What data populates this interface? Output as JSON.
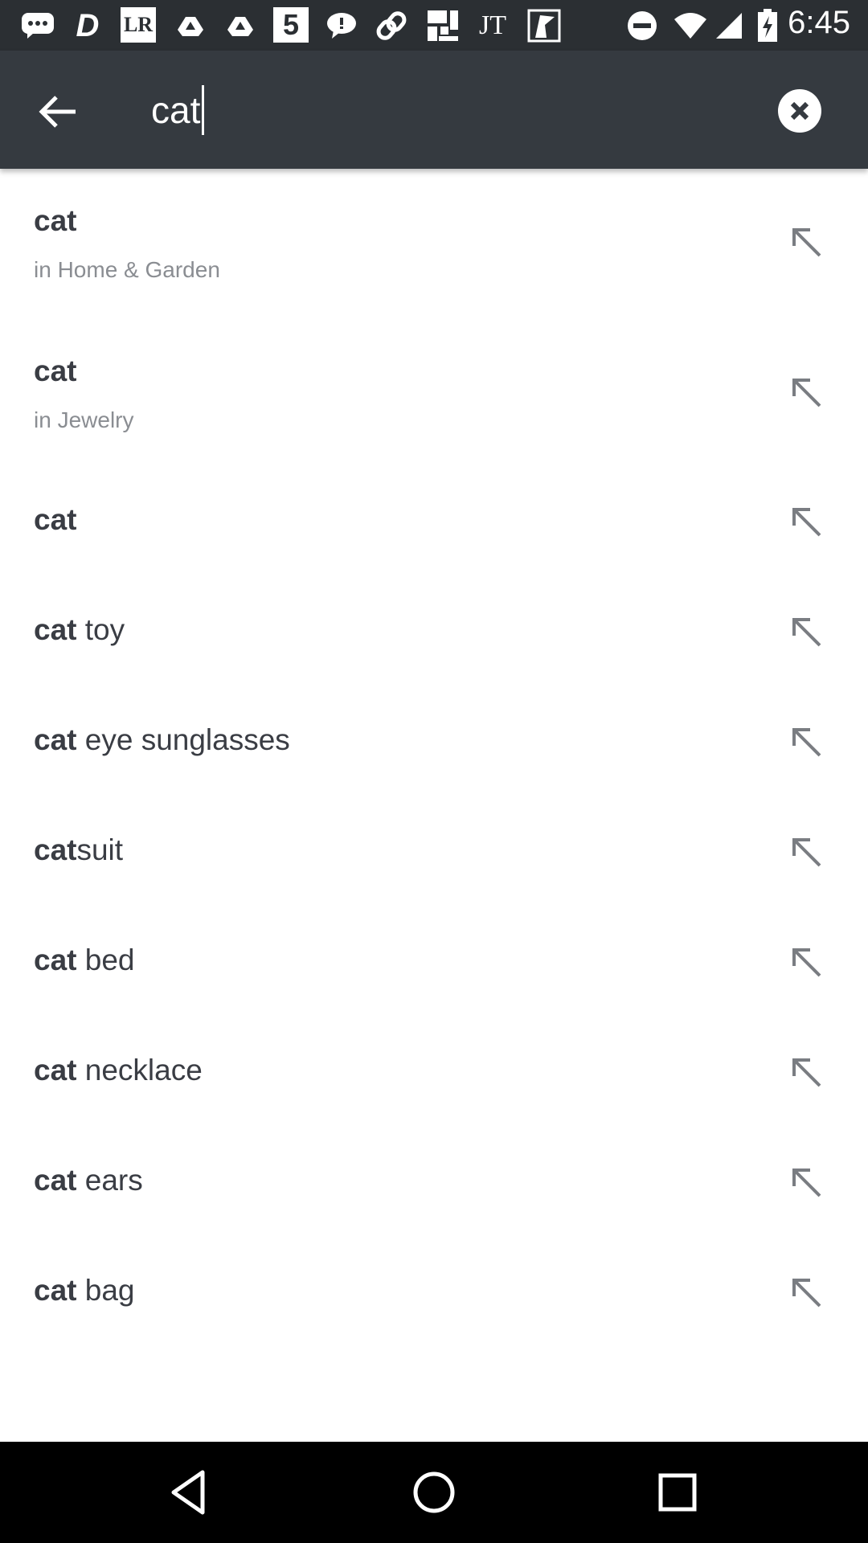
{
  "status_bar": {
    "time": "6:45",
    "notification_icons": [
      "chat-bubble-icon",
      "d-app-icon",
      "lr-app-icon",
      "cloud-drive-icon",
      "cloud-drive-icon",
      "number-5-app-icon",
      "message-icon",
      "link-app-icon",
      "grid-app-icon",
      "jt-app-icon",
      "image-app-icon"
    ],
    "notification_labels": {
      "lr": "LR",
      "jt": "JT",
      "five": "5",
      "d": "D"
    },
    "system_icons": [
      "do-not-disturb-icon",
      "wifi-icon",
      "cell-signal-icon",
      "battery-charging-icon"
    ]
  },
  "search": {
    "query": "cat"
  },
  "suggestions": [
    {
      "bold": "cat",
      "rest": "",
      "category": "in Home & Garden"
    },
    {
      "bold": "cat",
      "rest": "",
      "category": "in Jewelry"
    },
    {
      "bold": "cat",
      "rest": "",
      "category": ""
    },
    {
      "bold": "cat",
      "rest": " toy",
      "category": ""
    },
    {
      "bold": "cat",
      "rest": " eye sunglasses",
      "category": ""
    },
    {
      "bold": "cat",
      "rest": "suit",
      "category": ""
    },
    {
      "bold": "cat",
      "rest": " bed",
      "category": ""
    },
    {
      "bold": "cat",
      "rest": " necklace",
      "category": ""
    },
    {
      "bold": "cat",
      "rest": " ears",
      "category": ""
    },
    {
      "bold": "cat",
      "rest": " bag",
      "category": ""
    }
  ],
  "colors": {
    "toolbar": "#353a40",
    "status_bar": "#2b2f33",
    "text": "#3a3d44",
    "subtext": "#8a8d92",
    "icon": "#7a7d82"
  }
}
